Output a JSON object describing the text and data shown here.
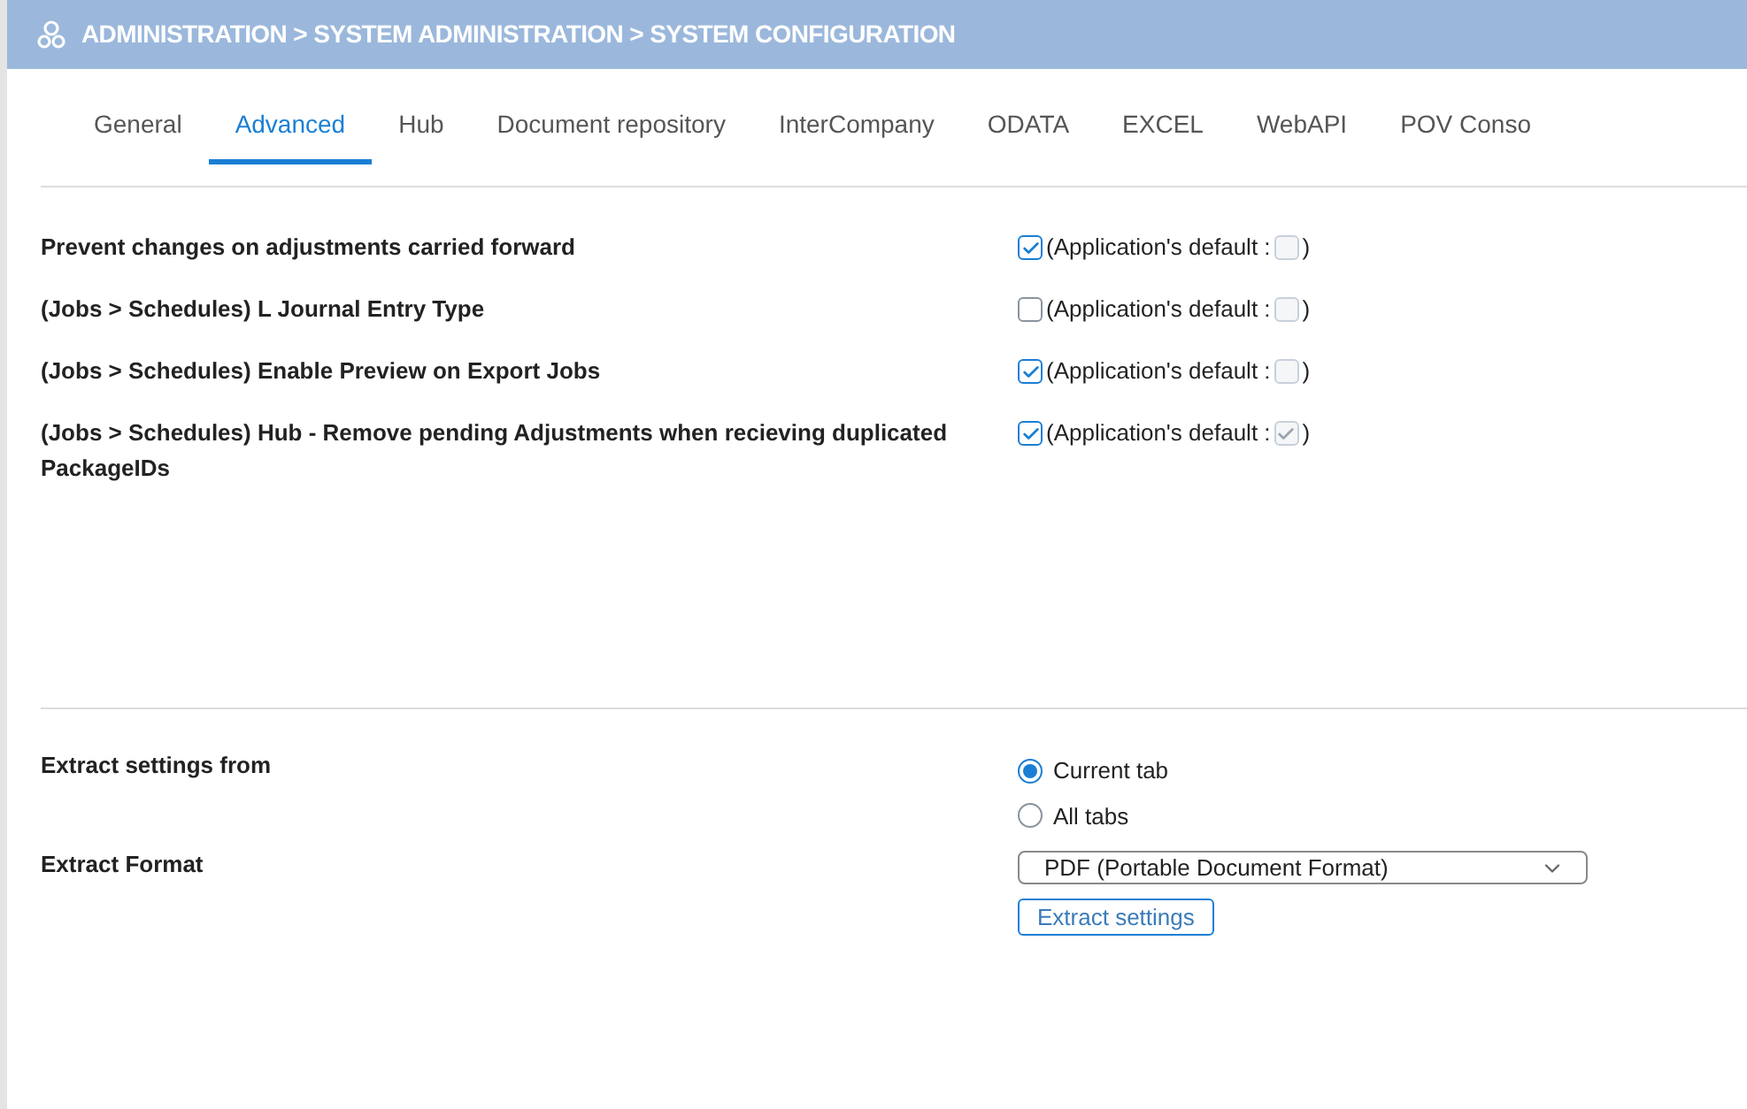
{
  "header": {
    "title": "ADMINISTRATION > SYSTEM ADMINISTRATION > SYSTEM CONFIGURATION"
  },
  "tabs": [
    {
      "label": "General",
      "selected": false
    },
    {
      "label": "Advanced",
      "selected": true
    },
    {
      "label": "Hub",
      "selected": false
    },
    {
      "label": "Document repository",
      "selected": false
    },
    {
      "label": "InterCompany",
      "selected": false
    },
    {
      "label": "ODATA",
      "selected": false
    },
    {
      "label": "EXCEL",
      "selected": false
    },
    {
      "label": "WebAPI",
      "selected": false
    },
    {
      "label": "POV Conso",
      "selected": false
    }
  ],
  "settings": [
    {
      "label": "Prevent changes on adjustments carried forward",
      "checked": true,
      "default_prefix": "(Application's default :",
      "default_checked": false,
      "default_suffix": ")"
    },
    {
      "label": "(Jobs > Schedules) L Journal Entry Type",
      "checked": false,
      "default_prefix": "(Application's default :",
      "default_checked": false,
      "default_suffix": ")"
    },
    {
      "label": "(Jobs > Schedules) Enable Preview on Export Jobs",
      "checked": true,
      "default_prefix": "(Application's default :",
      "default_checked": false,
      "default_suffix": ")"
    },
    {
      "label": "(Jobs > Schedules) Hub - Remove pending Adjustments when recieving duplicated PackageIDs",
      "checked": true,
      "default_prefix": "(Application's default :",
      "default_checked": true,
      "default_suffix": ")"
    }
  ],
  "extract": {
    "source_label": "Extract settings from",
    "options": [
      {
        "label": "Current tab",
        "selected": true
      },
      {
        "label": "All tabs",
        "selected": false
      }
    ],
    "format_label": "Extract Format",
    "format_value": "PDF (Portable Document Format)",
    "button": "Extract settings"
  }
}
